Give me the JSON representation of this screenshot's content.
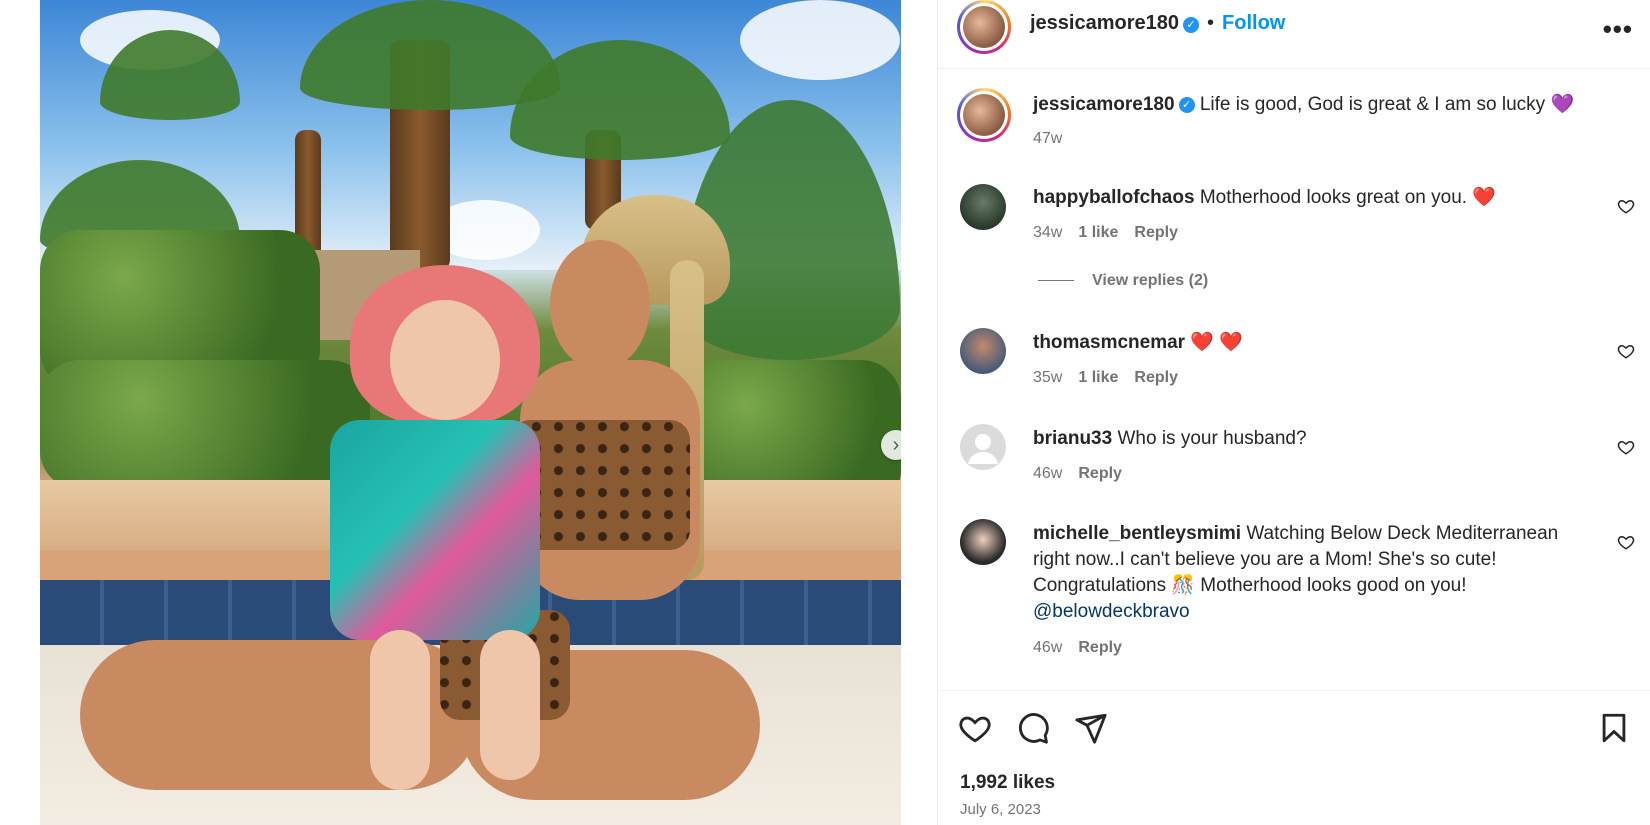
{
  "post": {
    "author": "jessicamore180",
    "follow_label": "Follow",
    "separator": "•",
    "more_label": "•••",
    "caption": "Life is good, God is great & I am so lucky 💜",
    "caption_age": "47w",
    "likes": "1,992 likes",
    "date": "July 6, 2023"
  },
  "comments": [
    {
      "user": "happyballofchaos",
      "text": "Motherhood looks great on you. ❤️",
      "age": "34w",
      "likes": "1 like",
      "reply": "Reply"
    },
    {
      "user": "thomasmcnemar",
      "text": "❤️ ❤️",
      "age": "35w",
      "likes": "1 like",
      "reply": "Reply"
    },
    {
      "user": "brianu33",
      "text": "Who is your husband?",
      "age": "46w",
      "reply": "Reply"
    },
    {
      "user": "michelle_bentleysmimi",
      "text_line1": "Watching Below Deck Mediterranean",
      "text_line2": "right now..I can't believe you are a Mom! She's so cute!",
      "text_line3": "Congratulations 🎊 Motherhood looks good on you!",
      "mention": "@belowdeckbravo",
      "age": "46w",
      "reply": "Reply"
    }
  ],
  "view_replies": "View replies (2)",
  "icons": {
    "like": "heart-icon",
    "comment": "comment-icon",
    "share": "send-icon",
    "save": "bookmark-icon",
    "next": "chevron-right-icon",
    "verified": "verified-icon"
  },
  "colors": {
    "follow": "#0095f6",
    "verified": "#1e95f5",
    "muted": "#737373",
    "mention": "#00376b"
  }
}
